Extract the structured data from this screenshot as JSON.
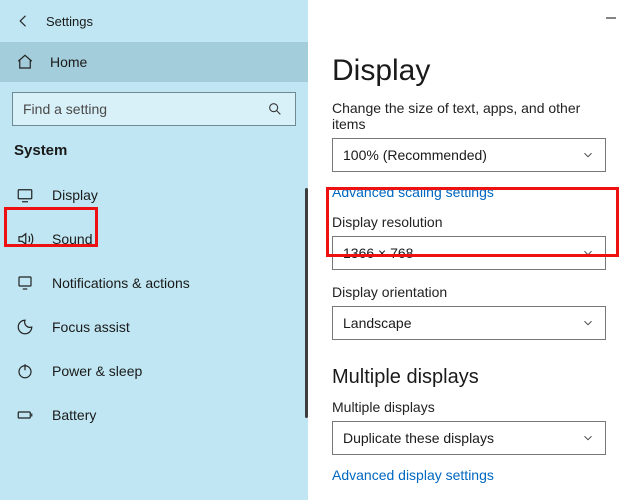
{
  "window": {
    "title": "Settings"
  },
  "sidebar": {
    "home_label": "Home",
    "search_placeholder": "Find a setting",
    "category": "System",
    "items": [
      {
        "label": "Display"
      },
      {
        "label": "Sound"
      },
      {
        "label": "Notifications & actions"
      },
      {
        "label": "Focus assist"
      },
      {
        "label": "Power & sleep"
      },
      {
        "label": "Battery"
      }
    ]
  },
  "main": {
    "page_title": "Display",
    "scale_label": "Change the size of text, apps, and other items",
    "scale_value": "100% (Recommended)",
    "advanced_scaling_link": "Advanced scaling settings",
    "resolution_label": "Display resolution",
    "resolution_value": "1366 × 768",
    "orientation_label": "Display orientation",
    "orientation_value": "Landscape",
    "multiple_section": "Multiple displays",
    "multiple_label": "Multiple displays",
    "multiple_value": "Duplicate these displays",
    "advanced_display_link": "Advanced display settings"
  }
}
